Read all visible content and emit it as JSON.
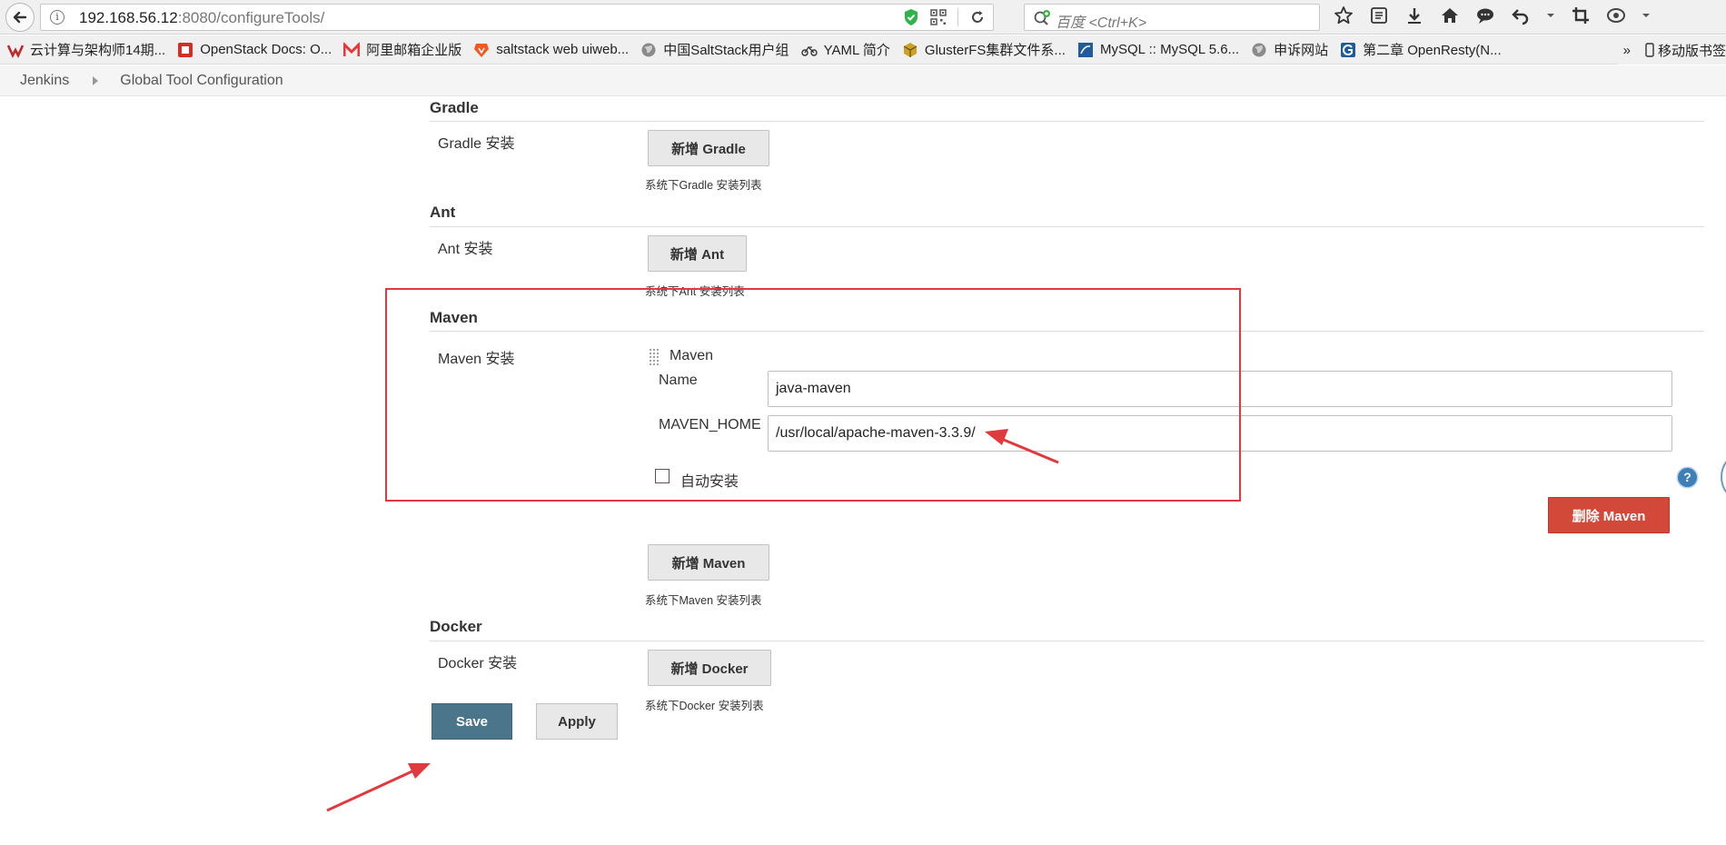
{
  "browser": {
    "url_host": "192.168.56.12",
    "url_rest": ":8080/configureTools/",
    "search_placeholder": "百度 <Ctrl+K>"
  },
  "bookmarks": [
    {
      "label": "云计算与架构师14期...",
      "icon": "v-logo-icon",
      "color": "#1a1a1a"
    },
    {
      "label": "OpenStack Docs: O...",
      "icon": "openstack-icon",
      "color": "#d22f27"
    },
    {
      "label": "阿里邮箱企业版",
      "icon": "aliyun-mail-icon",
      "color": "#e4393c"
    },
    {
      "label": "saltstack web uiweb...",
      "icon": "brave-icon",
      "color": "#f05a22"
    },
    {
      "label": "中国SaltStack用户组",
      "icon": "globe-icon",
      "color": "#7a7a7a"
    },
    {
      "label": "YAML 简介",
      "icon": "bicycle-icon",
      "color": "#333333"
    },
    {
      "label": "GlusterFS集群文件系...",
      "icon": "package-icon",
      "color": "#c9a227"
    },
    {
      "label": "MySQL :: MySQL 5.6...",
      "icon": "mysql-icon",
      "color": "#1f5c99"
    },
    {
      "label": "申诉网站",
      "icon": "globe-icon",
      "color": "#7a7a7a"
    },
    {
      "label": "第二章 OpenResty(N...",
      "icon": "g-icon",
      "color": "#1f5c99"
    }
  ],
  "bookmarks_more": "»",
  "bookmarks_mobile": "移动版书签",
  "breadcrumb": {
    "root": "Jenkins",
    "current": "Global Tool Configuration"
  },
  "gradle": {
    "title": "Gradle",
    "label": "Gradle 安装",
    "add_button": "新增 Gradle",
    "hint": "系统下Gradle 安装列表"
  },
  "ant": {
    "title": "Ant",
    "label": "Ant 安装",
    "add_button": "新增 Ant",
    "hint": "系统下Ant 安装列表"
  },
  "maven": {
    "title": "Maven",
    "label": "Maven 安装",
    "installation_header": "Maven",
    "name_label": "Name",
    "name_value": "java-maven",
    "home_label": "MAVEN_HOME",
    "home_value": "/usr/local/apache-maven-3.3.9/",
    "auto_install_label": "自动安装",
    "auto_install_checked": false,
    "delete_button": "删除 Maven",
    "add_button": "新增 Maven",
    "hint": "系统下Maven 安装列表"
  },
  "docker": {
    "title": "Docker",
    "label": "Docker 安装",
    "add_button": "新增 Docker",
    "hint": "系统下Docker 安装列表"
  },
  "help_icon": "?",
  "actions": {
    "save": "Save",
    "apply": "Apply"
  },
  "colors": {
    "save": "#4b758b",
    "delete": "#d24939",
    "annotation": "#e0393e",
    "help": "#3e7fb8"
  }
}
